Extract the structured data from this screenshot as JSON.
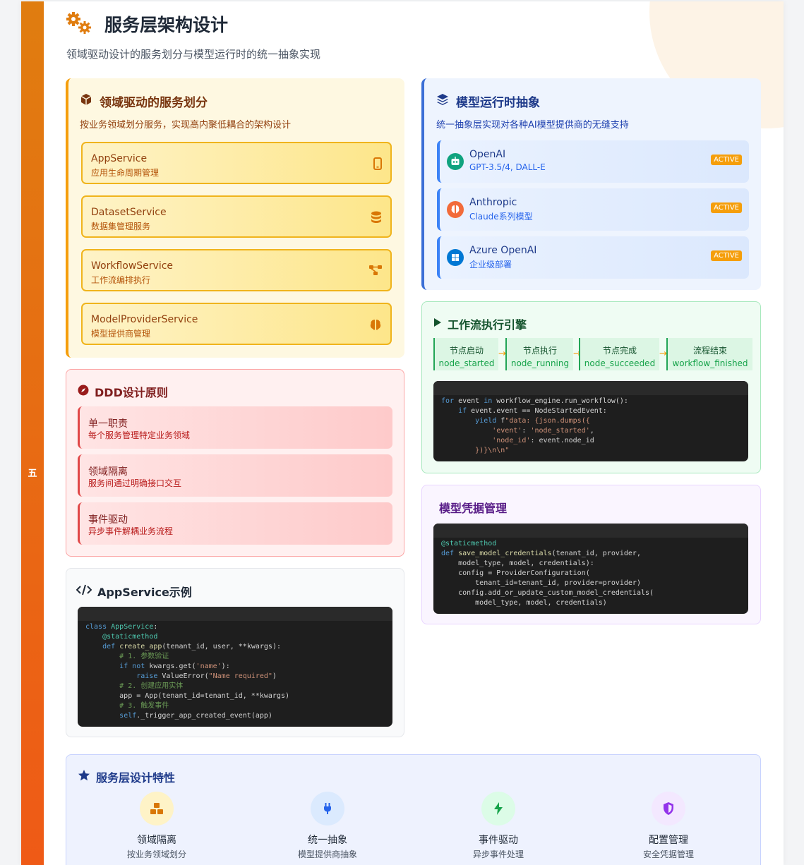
{
  "side": {
    "label": "五"
  },
  "header": {
    "title": "服务层架构设计",
    "subtitle": "领域驱动设计的服务划分与模型运行时的统一抽象实现"
  },
  "domain": {
    "title": "领域驱动的服务划分",
    "desc": "按业务领域划分服务，实现高内聚低耦合的架构设计",
    "services": [
      {
        "name": "AppService",
        "desc": "应用生命周期管理",
        "icon": "mobile-icon"
      },
      {
        "name": "DatasetService",
        "desc": "数据集管理服务",
        "icon": "database-icon"
      },
      {
        "name": "WorkflowService",
        "desc": "工作流编排执行",
        "icon": "flow-icon"
      },
      {
        "name": "ModelProviderService",
        "desc": "模型提供商管理",
        "icon": "brain-icon"
      }
    ]
  },
  "runtime": {
    "title": "模型运行时抽象",
    "desc": "统一抽象层实现对各种AI模型提供商的无缝支持",
    "providers": [
      {
        "name": "OpenAI",
        "desc": "GPT-3.5/4, DALL-E",
        "badge": "ACTIVE",
        "icon": "robot-icon",
        "color": "#10a37f"
      },
      {
        "name": "Anthropic",
        "desc": "Claude系列模型",
        "badge": "ACTIVE",
        "icon": "brain-icon",
        "color": "#f26b3a"
      },
      {
        "name": "Azure OpenAI",
        "desc": "企业级部署",
        "badge": "ACTIVE",
        "icon": "windows-icon",
        "color": "#0078d4"
      }
    ]
  },
  "ddd": {
    "title": "DDD设计原则",
    "principles": [
      {
        "name": "单一职责",
        "desc": "每个服务管理特定业务领域"
      },
      {
        "name": "领域隔离",
        "desc": "服务间通过明确接口交互"
      },
      {
        "name": "事件驱动",
        "desc": "异步事件解耦业务流程"
      }
    ]
  },
  "example": {
    "title": "AppService示例"
  },
  "workflow": {
    "title": "工作流执行引擎",
    "steps": [
      {
        "name": "节点启动",
        "event": "node_started"
      },
      {
        "name": "节点执行",
        "event": "node_running"
      },
      {
        "name": "节点完成",
        "event": "node_succeeded"
      },
      {
        "name": "流程结束",
        "event": "workflow_finished"
      }
    ],
    "arrow": "→"
  },
  "credentials": {
    "title": "模型凭据管理"
  },
  "features": {
    "title": "服务层设计特性",
    "items": [
      {
        "name": "领域隔离",
        "desc": "按业务领域划分",
        "icon": "cubes-icon",
        "color": "#fef3c7"
      },
      {
        "name": "统一抽象",
        "desc": "模型提供商抽象",
        "icon": "plug-icon",
        "color": "#dbeafe"
      },
      {
        "name": "事件驱动",
        "desc": "异步事件处理",
        "icon": "bolt-icon",
        "color": "#dcfce7"
      },
      {
        "name": "配置管理",
        "desc": "安全凭据管理",
        "icon": "shield-icon",
        "color": "#f3e8ff"
      }
    ]
  }
}
